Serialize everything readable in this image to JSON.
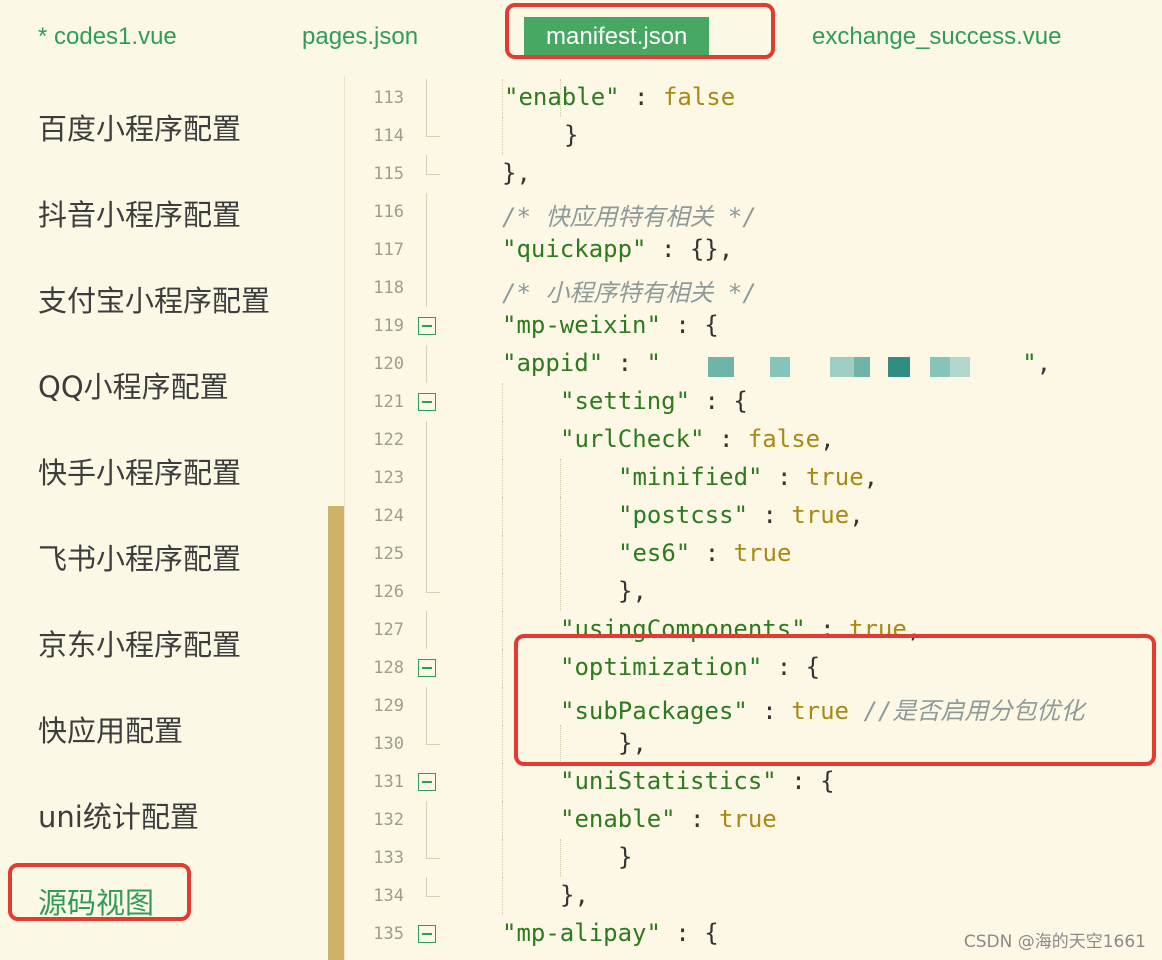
{
  "tabs": [
    {
      "label": "* codes1.vue",
      "active": false
    },
    {
      "label": "pages.json",
      "active": false
    },
    {
      "label": "manifest.json",
      "active": true
    },
    {
      "label": "exchange_success.vue",
      "active": false
    }
  ],
  "sidebar": {
    "items": [
      {
        "label": "百度小程序配置"
      },
      {
        "label": "抖音小程序配置"
      },
      {
        "label": "支付宝小程序配置"
      },
      {
        "label": "QQ小程序配置"
      },
      {
        "label": "快手小程序配置"
      },
      {
        "label": "飞书小程序配置"
      },
      {
        "label": "京东小程序配置"
      },
      {
        "label": "快应用配置"
      },
      {
        "label": "uni统计配置"
      },
      {
        "label": "源码视图",
        "active": true
      }
    ]
  },
  "editor": {
    "lines": [
      {
        "num": "113",
        "code": [
          [
            "k",
            "\"enable\""
          ],
          [
            "p",
            " : "
          ],
          [
            "v",
            "false"
          ]
        ]
      },
      {
        "num": "114",
        "code": [
          [
            "p",
            "}"
          ]
        ]
      },
      {
        "num": "115",
        "code": [
          [
            "p",
            "},"
          ]
        ]
      },
      {
        "num": "116",
        "code": [
          [
            "c",
            "/* 快应用特有相关 */"
          ]
        ]
      },
      {
        "num": "117",
        "code": [
          [
            "k",
            "\"quickapp\""
          ],
          [
            "p",
            " : {},"
          ]
        ]
      },
      {
        "num": "118",
        "code": [
          [
            "c",
            "/* 小程序特有相关 */"
          ]
        ]
      },
      {
        "num": "119",
        "code": [
          [
            "k",
            "\"mp-weixin\""
          ],
          [
            "p",
            " : {"
          ]
        ]
      },
      {
        "num": "120",
        "code": [
          [
            "k",
            "\"appid\""
          ],
          [
            "p",
            " : "
          ],
          [
            "k",
            "\""
          ],
          [
            "p",
            "                         "
          ],
          [
            "k",
            "\""
          ],
          [
            "p",
            ","
          ]
        ]
      },
      {
        "num": "121",
        "code": [
          [
            "k",
            "\"setting\""
          ],
          [
            "p",
            " : {"
          ]
        ]
      },
      {
        "num": "122",
        "code": [
          [
            "k",
            "\"urlCheck\""
          ],
          [
            "p",
            " : "
          ],
          [
            "v",
            "false"
          ],
          [
            "p",
            ","
          ]
        ]
      },
      {
        "num": "123",
        "code": [
          [
            "k",
            "\"minified\""
          ],
          [
            "p",
            " : "
          ],
          [
            "v",
            "true"
          ],
          [
            "p",
            ","
          ]
        ]
      },
      {
        "num": "124",
        "code": [
          [
            "k",
            "\"postcss\""
          ],
          [
            "p",
            " : "
          ],
          [
            "v",
            "true"
          ],
          [
            "p",
            ","
          ]
        ]
      },
      {
        "num": "125",
        "code": [
          [
            "k",
            "\"es6\""
          ],
          [
            "p",
            " : "
          ],
          [
            "v",
            "true"
          ]
        ]
      },
      {
        "num": "126",
        "code": [
          [
            "p",
            "},"
          ]
        ]
      },
      {
        "num": "127",
        "code": [
          [
            "k",
            "\"usingComponents\""
          ],
          [
            "p",
            " : "
          ],
          [
            "v",
            "true"
          ],
          [
            "p",
            ","
          ]
        ]
      },
      {
        "num": "128",
        "code": [
          [
            "k",
            "\"optimization\""
          ],
          [
            "p",
            " : {"
          ]
        ]
      },
      {
        "num": "129",
        "code": [
          [
            "k",
            "\"subPackages\""
          ],
          [
            "p",
            " : "
          ],
          [
            "v",
            "true"
          ],
          [
            "c",
            " //是否启用分包优化"
          ]
        ]
      },
      {
        "num": "130",
        "code": [
          [
            "p",
            "},"
          ]
        ]
      },
      {
        "num": "131",
        "code": [
          [
            "k",
            "\"uniStatistics\""
          ],
          [
            "p",
            " : {"
          ]
        ]
      },
      {
        "num": "132",
        "code": [
          [
            "k",
            "\"enable\""
          ],
          [
            "p",
            " : "
          ],
          [
            "v",
            "true"
          ]
        ]
      },
      {
        "num": "133",
        "code": [
          [
            "p",
            "}"
          ]
        ]
      },
      {
        "num": "134",
        "code": [
          [
            "p",
            "},"
          ]
        ]
      },
      {
        "num": "135",
        "code": [
          [
            "k",
            "\"mp-alipay\""
          ],
          [
            "p",
            " : {"
          ]
        ]
      }
    ]
  },
  "watermark": "CSDN @海的天空1661",
  "colors": {
    "accent": "#46a862",
    "annotation": "#e53a2f",
    "background": "#fcf8e6",
    "key": "#2d7a1f",
    "value": "#a88a13"
  }
}
